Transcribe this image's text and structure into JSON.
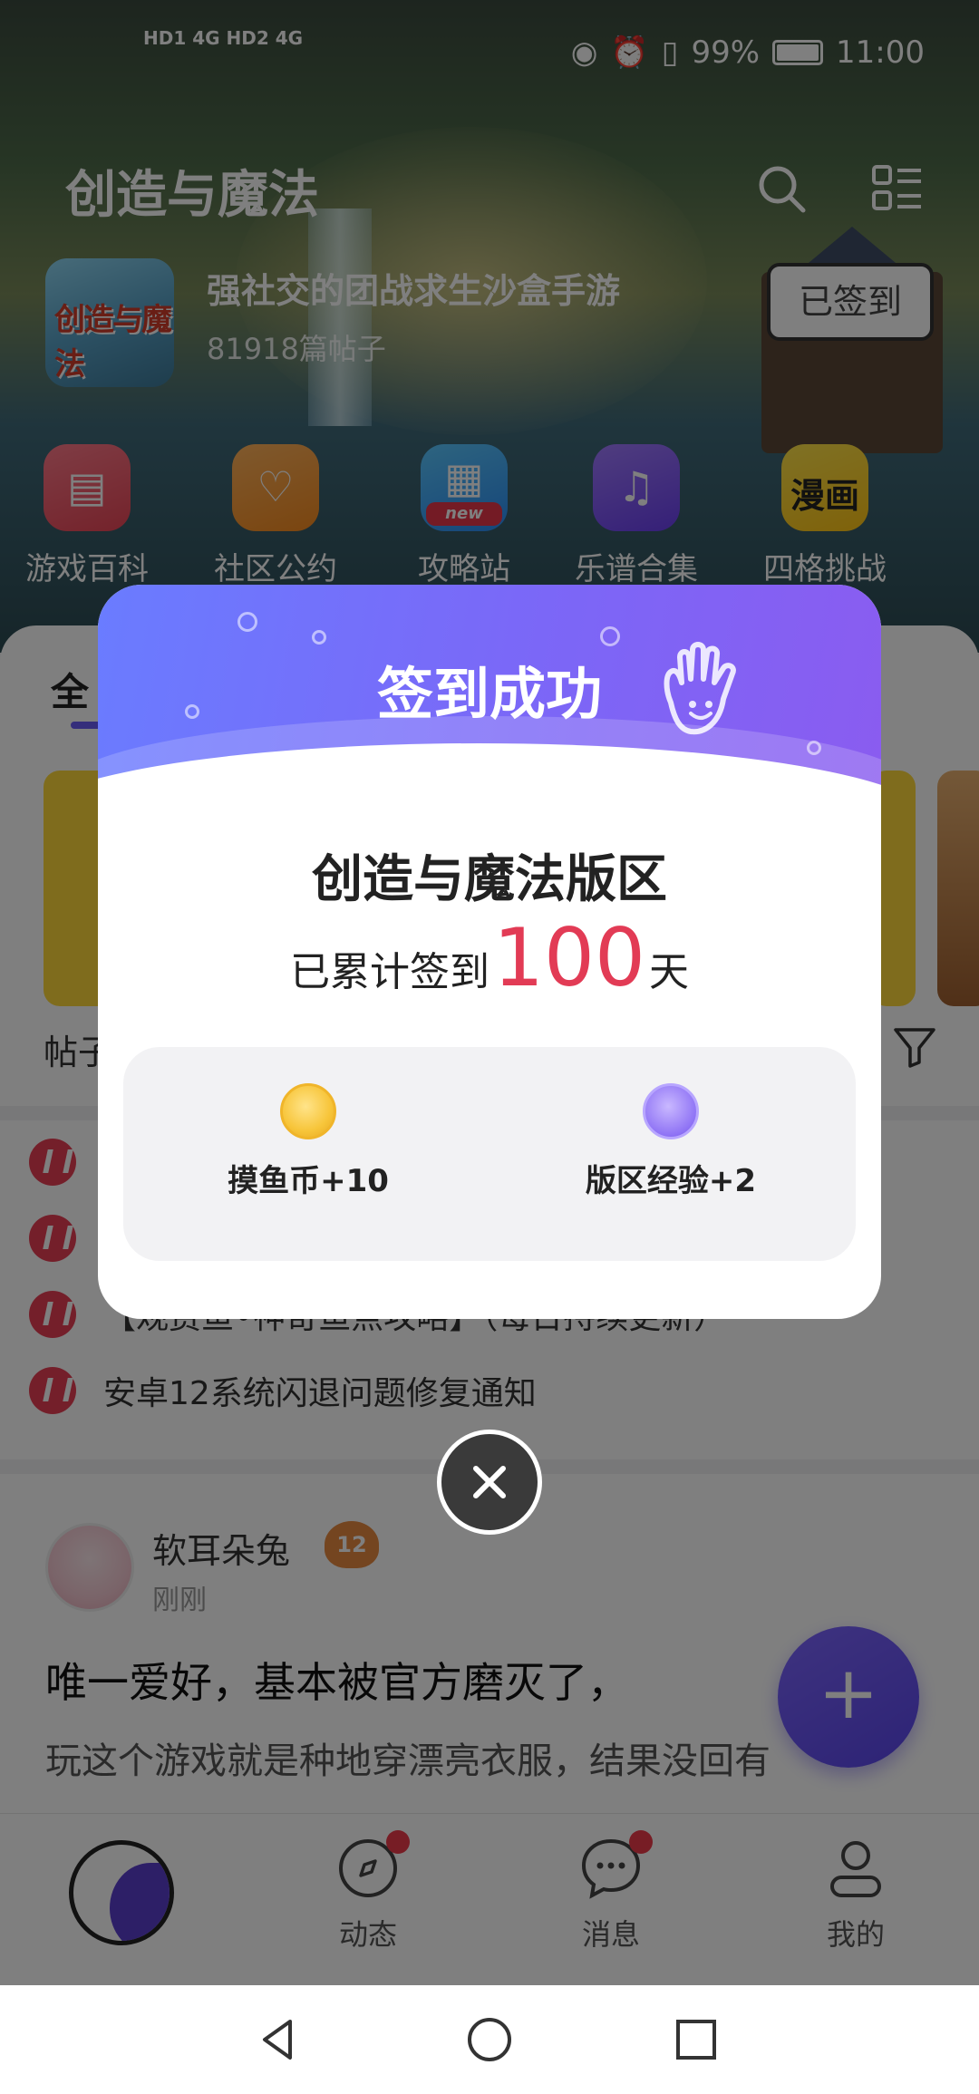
{
  "status_bar": {
    "left_text": "HD1 4G  HD2 4G",
    "battery": "99%",
    "time": "11:00"
  },
  "header": {
    "title": "创造与魔法",
    "forum_description": "强社交的团战求生沙盒手游",
    "post_count": "81918篇帖子",
    "signed_button": "已签到",
    "logo_text": "创造与魔法"
  },
  "quick_menu": [
    {
      "label": "游戏百科",
      "icon": "book-icon"
    },
    {
      "label": "社区公约",
      "icon": "handshake-icon"
    },
    {
      "label": "攻略站",
      "icon": "grid-icon",
      "badge": "new"
    },
    {
      "label": "乐谱合集",
      "icon": "music-icon"
    },
    {
      "label": "四格挑战",
      "icon": "comic-icon",
      "glyph": "漫画"
    }
  ],
  "content": {
    "tab_partial": "全",
    "sub_tab_partial": "帖子",
    "notices": [
      "",
      "",
      "【观赏鱼•神奇鱼点攻略】（每日持续更新）",
      "安卓12系统闪退问题修复通知"
    ],
    "post": {
      "user": "软耳朵兔",
      "level": "12",
      "time": "刚刚",
      "title": "唯一爱好，基本被官方磨灭了，",
      "body": "玩这个游戏就是种地穿漂亮衣服，结果没回有"
    },
    "fab": "+"
  },
  "tabbar": [
    {
      "label": "",
      "icon": "home-fish-icon"
    },
    {
      "label": "动态",
      "icon": "compass-icon",
      "dot": true
    },
    {
      "label": "消息",
      "icon": "chat-icon",
      "dot": true
    },
    {
      "label": "我的",
      "icon": "profile-icon",
      "dot": false
    }
  ],
  "modal": {
    "title": "签到成功",
    "forum_name": "创造与魔法版区",
    "days_prefix": "已累计签到",
    "days": "100",
    "days_suffix": "天",
    "rewards": [
      {
        "label": "摸鱼币+10",
        "icon": "fish-coin-icon"
      },
      {
        "label": "版区经验+2",
        "icon": "experience-star-icon"
      }
    ]
  },
  "colors": {
    "accent": "#6b5cf6",
    "highlight_number": "#e23b55",
    "notice_pin": "#e83f55"
  }
}
